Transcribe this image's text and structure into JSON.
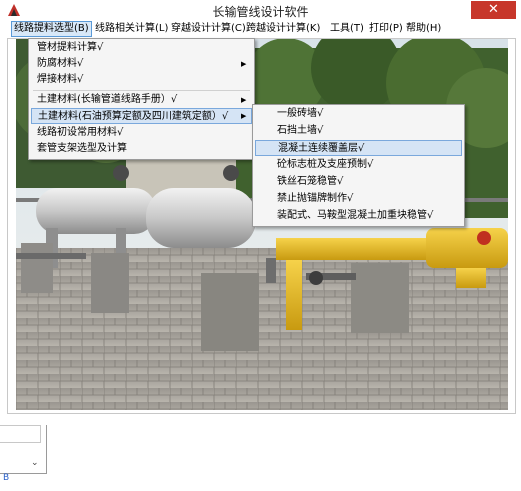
{
  "window": {
    "title": "长输管线设计软件",
    "close_label": "✕"
  },
  "menubar": [
    "线路提料选型(B)",
    "线路相关计算(L)",
    "穿越设计计算(C)",
    "跨越设计计算(K)",
    "工具(T)",
    "打印(P)",
    "帮助(H)"
  ],
  "main_menu": {
    "items": [
      {
        "label": "管材提料计算√",
        "submenu": false
      },
      {
        "label": "防腐材料√",
        "submenu": true
      },
      {
        "label": "焊接材料√",
        "submenu": false
      },
      {
        "label": "土建材料(长输管道线路手册）√",
        "submenu": true
      },
      {
        "label": "土建材料(石油预算定额及四川建筑定额）√",
        "submenu": true,
        "selected": true
      },
      {
        "label": "线路初设常用材料√",
        "submenu": false
      },
      {
        "label": "套管支架选型及计算",
        "submenu": false
      }
    ]
  },
  "sub_menu": {
    "items": [
      {
        "label": "一般砖墙√"
      },
      {
        "label": "石挡土墙√"
      },
      {
        "label": "混凝土连续覆盖层√",
        "selected": true
      },
      {
        "label": "砼标志桩及支座预制√"
      },
      {
        "label": "铁丝石笼稳管√"
      },
      {
        "label": "禁止抛锚牌制作√"
      },
      {
        "label": "装配式、马鞍型混凝土加重块稳管√"
      }
    ]
  },
  "bottom": {
    "scroll_glyph": "⌄",
    "corner_text": "B"
  },
  "colors": {
    "accent": "#5a9ad8",
    "highlight": "#d5e4f5",
    "close": "#c7362a"
  }
}
